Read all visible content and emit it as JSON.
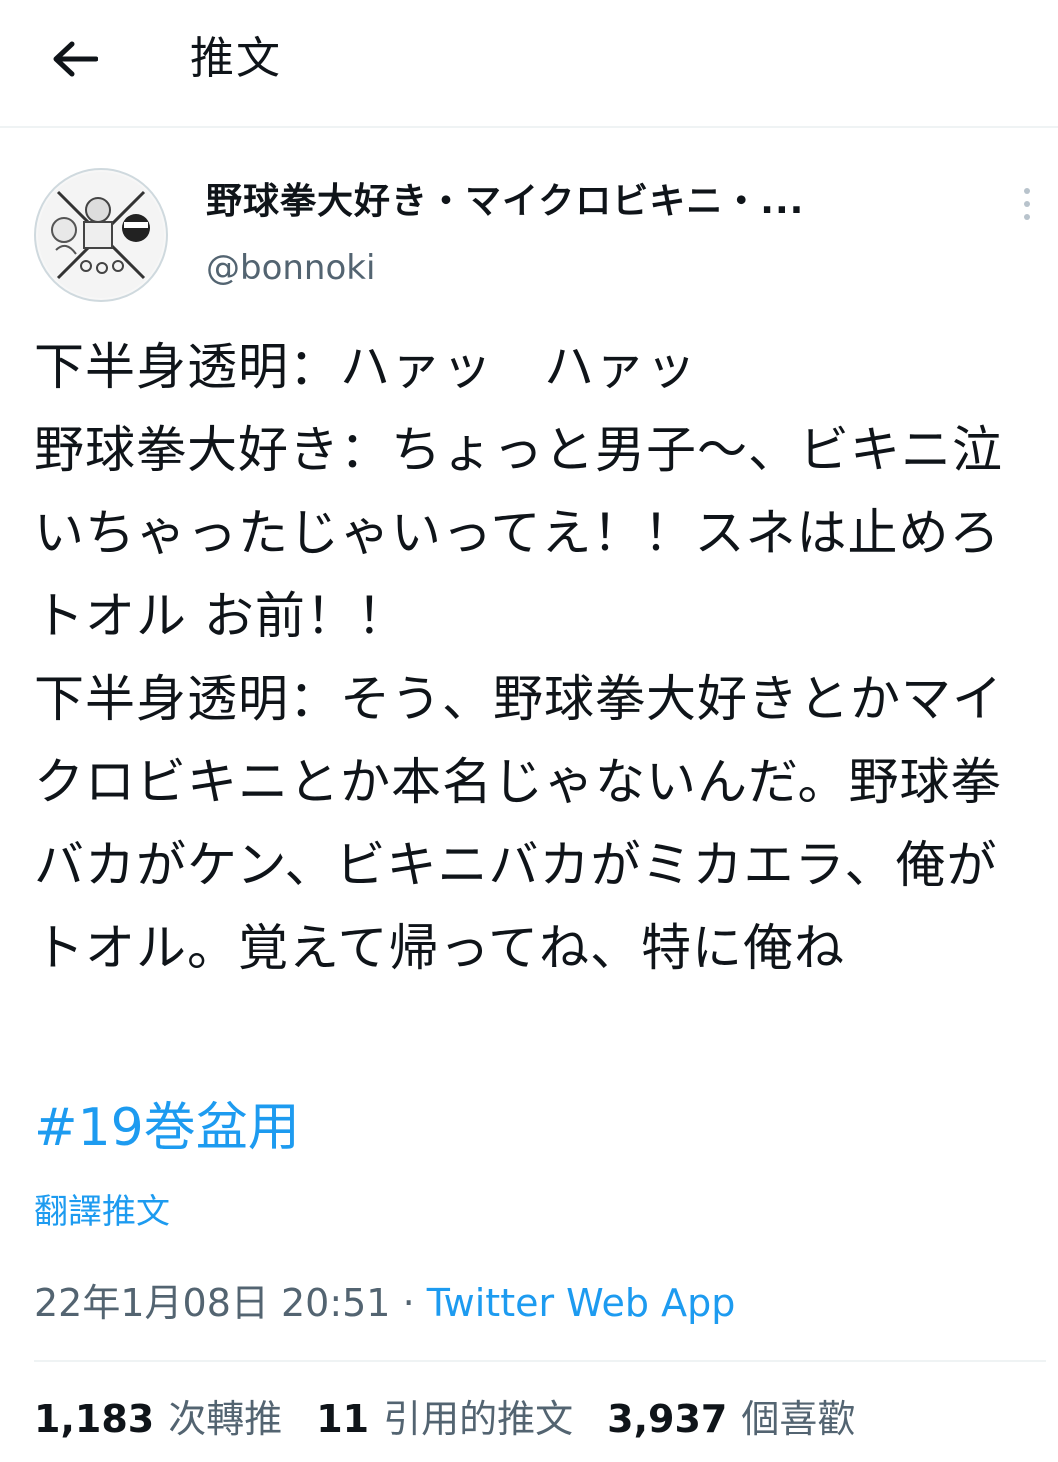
{
  "header": {
    "title": "推文",
    "back_icon": "arrow-left-icon"
  },
  "author": {
    "display_name": "野球拳大好き・マイクロビキニ・...",
    "handle": "@bonnoki",
    "avatar": "avatar-image",
    "more_icon": "more-vertical-icon"
  },
  "tweet": {
    "text": "下半身透明：ハァッ　ハァッ\n野球拳大好き：ちょっと男子〜、ビキニ泣いちゃったじゃいってえ！！スネは止めろトオル お前！！\n下半身透明：そう、野球拳大好きとかマイクロビキニとか本名じゃないんだ。野球拳バカがケン、ビキニバカがミカエラ、俺がトオル。覚えて帰ってね、特に俺ね",
    "hashtag": "#19巻盆用",
    "translate": "翻譯推文",
    "timestamp": "22年1月08日 20:51",
    "separator": " · ",
    "source": "Twitter Web App"
  },
  "stats": {
    "retweets": {
      "count": "1,183",
      "label": "次轉推"
    },
    "quotes": {
      "count": "11",
      "label": "引用的推文"
    },
    "likes": {
      "count": "3,937",
      "label": "個喜歡"
    }
  },
  "colors": {
    "link": "#1d9bf0",
    "secondary_text": "#536471",
    "divider": "#eff3f4"
  }
}
